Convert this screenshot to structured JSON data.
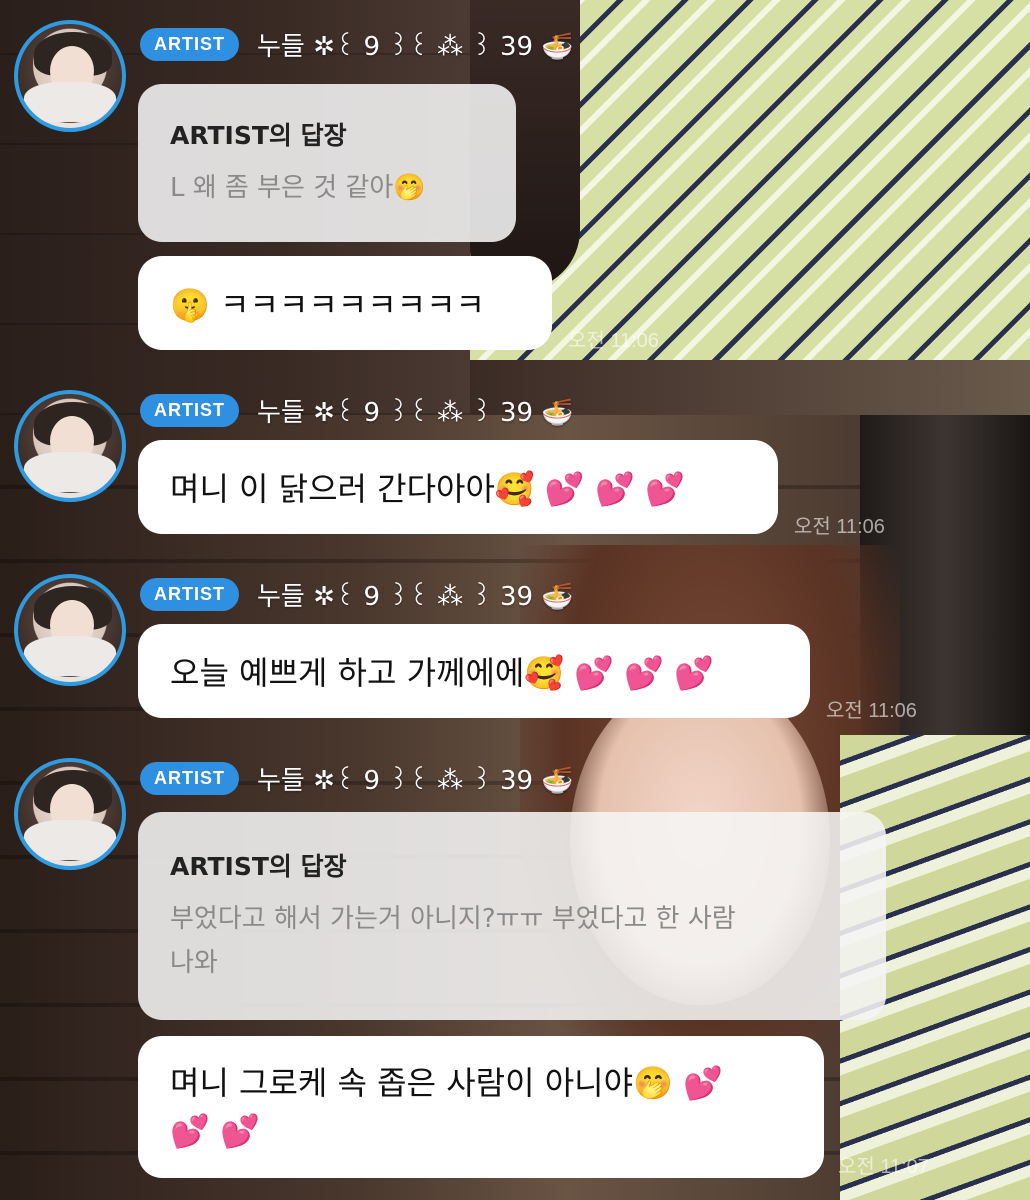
{
  "messages": [
    {
      "badge": "ARTIST",
      "nickname": "누들 ✲꒰ 9 ꒱꒰ ⁂ ꒱ 39 🍜",
      "reply": {
        "title": "ARTIST의 답장",
        "text": "L 왜 좀 부은 것 같아🤭"
      },
      "text": "🤫 ㅋㅋㅋㅋㅋㅋㅋㅋㅋ",
      "time": "오전 11:06"
    },
    {
      "badge": "ARTIST",
      "nickname": "누들 ✲꒰ 9 ꒱꒰ ⁂ ꒱ 39 🍜",
      "text": "며니 이 닭으러 간다아아🥰 💕 💕 💕",
      "time": "오전 11:06"
    },
    {
      "badge": "ARTIST",
      "nickname": "누들 ✲꒰ 9 ꒱꒰ ⁂ ꒱ 39 🍜",
      "text": "오늘 예쁘게 하고 가께에에🥰 💕 💕 💕",
      "time": "오전 11:06"
    },
    {
      "badge": "ARTIST",
      "nickname": "누들 ✲꒰ 9 ꒱꒰ ⁂ ꒱ 39 🍜",
      "reply": {
        "title": "ARTIST의 답장",
        "text_line1": "부었다고 해서 가는거 아니지?ㅠㅠ 부었다고 한 사람",
        "text_line2": "나와"
      },
      "text_line1": "며니 그로케 속 좁은 사람이 아니야🤭 💕",
      "text_line2": "💕 💕",
      "time": "오전 11:07"
    }
  ],
  "colors": {
    "badge": "#2f8fe0",
    "avatar_ring": "#2f9ae0",
    "bubble": "#ffffff",
    "reply_bubble": "#f5f5f5"
  },
  "icons": [
    "avatar-image",
    "noodle-bowl-emoji"
  ]
}
